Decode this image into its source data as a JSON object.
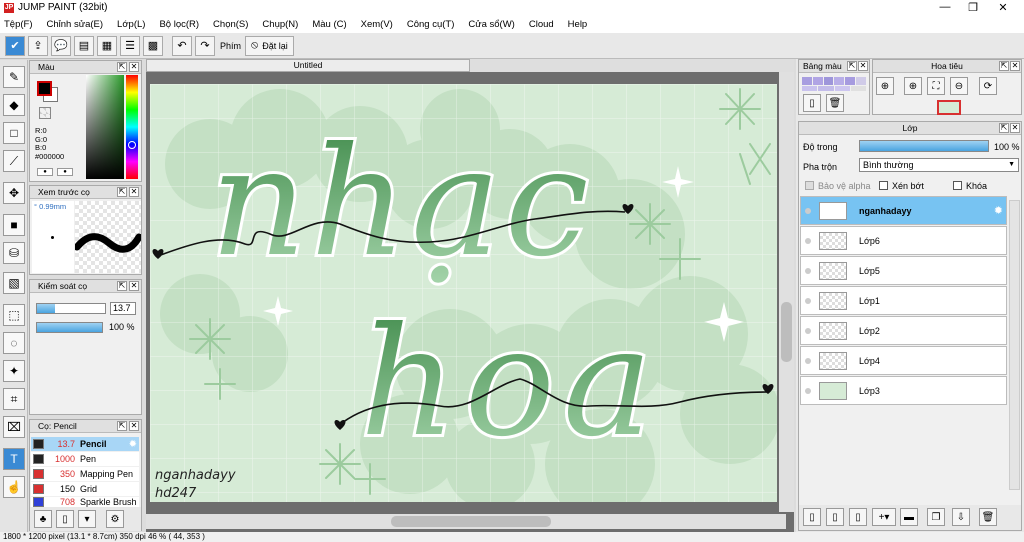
{
  "window": {
    "title": "JUMP PAINT (32bit)",
    "icon": "jp-icon",
    "controls": [
      "—",
      "❐",
      "✕"
    ]
  },
  "menu": [
    "Tệp(F)",
    "Chỉnh sửa(E)",
    "Lớp(L)",
    "Bộ lọc(R)",
    "Chọn(S)",
    "Chụp(N)",
    "Màu (C)",
    "Xem(V)",
    "Công cụ(T)",
    "Cửa sổ(W)",
    "Cloud",
    "Help"
  ],
  "toolbar": {
    "shortcut_label": "Phím",
    "reset_label": "Đặt lại"
  },
  "color_panel": {
    "title": "Màu",
    "r": "R:0",
    "g": "G:0",
    "b": "B:0",
    "hex": "#000000",
    "fg_color": "#000000",
    "bg_color": "#ffffff"
  },
  "preview_panel": {
    "title": "Xem trước cọ",
    "size": "° 0.99mm"
  },
  "brush_control": {
    "title": "Kiểm soát cọ",
    "size_value": "13.7",
    "opacity_value": "100 %",
    "opacity_fraction": 1.0
  },
  "brush_list": {
    "title": "Cọ: Pencil",
    "items": [
      {
        "value": "13.7",
        "name": "Pencil",
        "color": "#222222"
      },
      {
        "value": "1000",
        "name": "Pen",
        "color": "#222222"
      },
      {
        "value": "350",
        "name": "Mapping Pen",
        "color": "#d83030"
      },
      {
        "value": "150",
        "name": "Grid",
        "color": "#d83030"
      },
      {
        "value": "708",
        "name": "Sparkle Brush",
        "color": "#3040d8"
      }
    ]
  },
  "document": {
    "tab": "Untitled"
  },
  "artwork": {
    "line1": "nhạc",
    "line2": "hoa",
    "signature1": "nganhadayy",
    "signature2": "hd247",
    "bg_color": "#d6ebd6",
    "stroke_color": "#4e9a5a"
  },
  "palette_panel": {
    "title": "Bảng màu"
  },
  "navigator_panel": {
    "title": "Hoa tiêu"
  },
  "layer_panel": {
    "title": "Lớp",
    "opacity_label": "Độ trong",
    "opacity_value": "100 %",
    "opacity_fraction": 1.0,
    "blend_label": "Pha trộn",
    "blend_value": "Bình thường",
    "protect_alpha": "Bảo vệ alpha",
    "clipping": "Xén bớt",
    "lock": "Khóa",
    "layers": [
      "nganhadayy",
      "Lớp6",
      "Lớp5",
      "Lớp1",
      "Lớp2",
      "Lớp4",
      "Lớp3"
    ],
    "selected_index": 0
  },
  "status": "1800 * 1200 pixel   (13.1 * 8.7cm)   350 dpi   46 %   ( 44, 353 )"
}
